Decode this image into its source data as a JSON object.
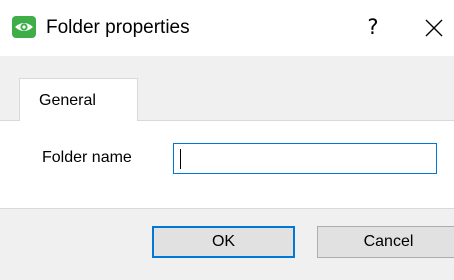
{
  "window": {
    "title": "Folder properties",
    "help_glyph": "?",
    "icons": {
      "app": "eye-icon",
      "close": "close-icon"
    },
    "colors": {
      "app_icon_green": "#3fae49",
      "focus_blue": "#0078d7"
    }
  },
  "tabs": [
    {
      "label": "General",
      "selected": true
    }
  ],
  "form": {
    "folder_name_label": "Folder name",
    "folder_name_value": ""
  },
  "buttons": {
    "ok_label": "OK",
    "cancel_label": "Cancel"
  }
}
